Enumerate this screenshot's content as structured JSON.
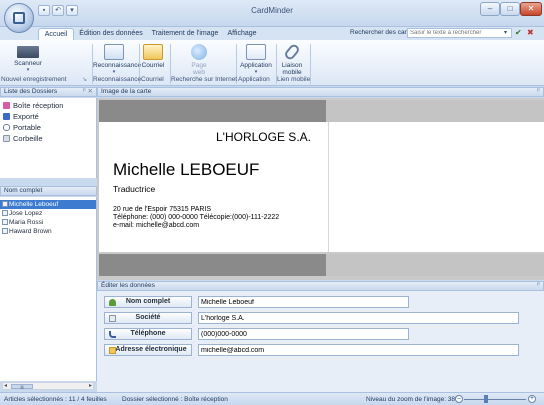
{
  "app_title": "CardMinder",
  "quick_access": [
    "save-icon",
    "undo-icon",
    "dropdown-arrow-icon"
  ],
  "tabs": [
    "Accueil",
    "Édition des données",
    "Traitement de l'image",
    "Affichage"
  ],
  "search": {
    "label": "Rechercher des cartes :",
    "placeholder": "Saisir le texte à rechercher"
  },
  "ribbon": {
    "scanner": "Scanneur",
    "reco": "Reconnaissance",
    "courriel": "Courriel",
    "page_web_1": "Page",
    "page_web_2": "web",
    "application": "Application",
    "liaison_1": "Liaison",
    "liaison_2": "mobile",
    "groups": [
      "Nouvel enregistrement",
      "Reconnaissance",
      "Courriel",
      "Recherche sur Internet",
      "Application",
      "Lien mobile"
    ]
  },
  "folders_pane": {
    "title": "Liste des Dossiers",
    "items": [
      "Boîte réception",
      "Exporté",
      "Portable",
      "Corbeille"
    ]
  },
  "names_pane": {
    "title": "Nom complet",
    "items": [
      "Michelle Leboeuf",
      "Jose Lopez",
      "Maria Rossi",
      "Haward Brown"
    ]
  },
  "card_pane": {
    "title": "Image de la carte",
    "company": "L'HORLOGE S.A.",
    "name": "Michelle LEBOEUF",
    "job": "Traductrice",
    "address": "20 rue de l'Espoir 75315 PARIS",
    "phone_line": "Téléphone: (000) 000-0000    Télécopie:(000)-111-2222",
    "email_line": "e-mail: michelle@abcd.com"
  },
  "edit_pane": {
    "title": "Éditer les données",
    "fields": [
      {
        "label": "Nom complet",
        "value": "Michelle Leboeuf"
      },
      {
        "label": "Société",
        "value": "L'horloge S.A."
      },
      {
        "label": "Téléphone",
        "value": "(000)000-0000"
      },
      {
        "label": "Adresse électronique",
        "value": "michelle@abcd.com"
      }
    ]
  },
  "status": {
    "selected": "Articles sélectionnés :  1",
    "sheets": "1 /  4 feuilles",
    "folder": "Dossier sélectionné : Boîte réception",
    "zoom": "Niveau du zoom de l'image: 38%"
  },
  "colors": {
    "accent": "#1e395b",
    "selection": "#3d7bd1",
    "ribbon_bg": "#dce7f5"
  }
}
